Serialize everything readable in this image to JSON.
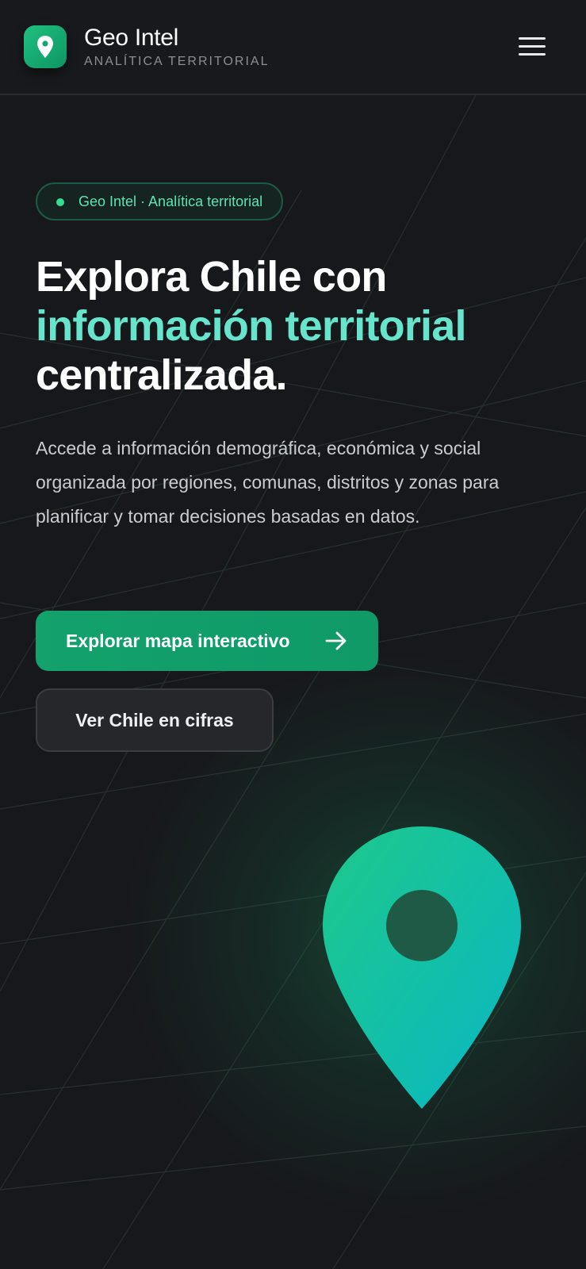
{
  "header": {
    "brand_name": "Geo Intel",
    "brand_subtitle": "ANALÍTICA TERRITORIAL",
    "logo_icon": "map-pin-icon",
    "menu_icon": "hamburger-menu-icon"
  },
  "hero": {
    "pill_text": "Geo Intel · Analítica territorial",
    "title_line1": "Explora Chile con",
    "title_accent": "información territorial",
    "title_line3": "centralizada.",
    "description": "Accede a información demográfica, económica y social organizada por regiones, comunas, distritos y zonas para planificar y tomar decisiones basadas en datos.",
    "primary_button": "Explorar mapa interactivo",
    "primary_button_icon": "arrow-right-icon",
    "secondary_button": "Ver Chile en cifras",
    "illustration_icon": "location-pin-icon"
  },
  "colors": {
    "background": "#17181b",
    "accent_green": "#13a16c",
    "accent_teal": "#67e4cc",
    "pin_gradient_start": "#1ec88a",
    "pin_gradient_end": "#08b8c4"
  }
}
